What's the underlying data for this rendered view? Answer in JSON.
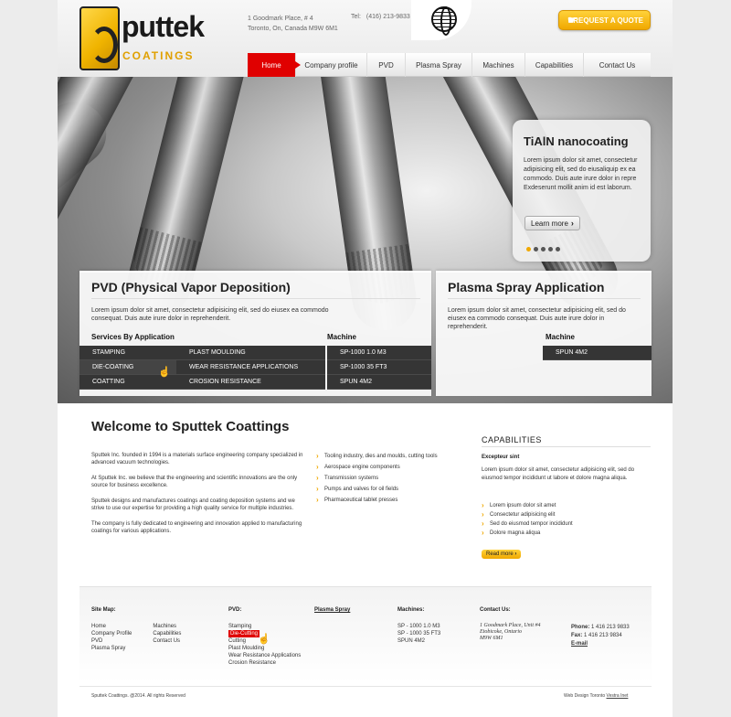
{
  "colors": {
    "accent_red": "#e00000",
    "accent_yellow": "#f0a800",
    "dark_panel": "#353535"
  },
  "header": {
    "logo_word": "puttek",
    "logo_sub": "COATINGS",
    "address_line1": "1 Goodmark Place, # 4",
    "address_line2": "Toronto, On, Canada M9W 6M1",
    "tel_label": "Tel:",
    "tel_value": "(416) 213-9833",
    "quote_button": "REQUEST A QUOTE",
    "globe_icon": "globe-icon"
  },
  "nav": {
    "items": [
      {
        "label": "Home",
        "active": true
      },
      {
        "label": "Company profile"
      },
      {
        "label": "PVD"
      },
      {
        "label": "Plasma Spray"
      },
      {
        "label": "Machines"
      },
      {
        "label": "Capabilities"
      },
      {
        "label": "Contact Us"
      }
    ]
  },
  "promo": {
    "title": "TiAlN nanocoating",
    "text": "Lorem ipsum dolor sit amet, consectetur adipisicing elit, sed do eiusaliquip ex ea commodo. Duis aute irure dolor in repre Exdeserunt mollit anim id est laborum.",
    "learn_more": "Learn more",
    "slides_total": 5,
    "active_slide": 1
  },
  "pvd_panel": {
    "title": "PVD (Physical Vapor Deposition)",
    "desc": "Lorem ipsum dolor sit amet, consectetur adipisicing elit, sed do eiusex ea commodo consequat. Duis aute irure dolor in reprehenderit.",
    "services_head": "Services By Application",
    "services_col1": [
      "STAMPING",
      "DIE-COATING",
      "COATTING"
    ],
    "services_col2": [
      "PLAST MOULDING",
      "WEAR RESISTANCE APPLICATIONS",
      "CROSION RESISTANCE"
    ],
    "machine_head": "Machine",
    "machines": [
      "SP-1000  1.0 M3",
      "SP-1000  35 FT3",
      "SPUN 4M2"
    ]
  },
  "plasma_panel": {
    "title": "Plasma Spray Application",
    "desc": "Lorem ipsum dolor sit amet, consectetur adipisicing elit, sed do eiusex ea commodo consequat. Duis aute irure dolor in reprehenderit.",
    "machine_head": "Machine",
    "machines": [
      "SPUN 4M2"
    ]
  },
  "welcome": {
    "title": "Welcome to Sputtek Coattings",
    "paragraphs": [
      "Sputtek Inc. founded in 1994 is a materials surface engineering company specialized in advanced vacuum technologies.",
      "At Sputtek Inc. we believe that the engineering and scientific innovations are the only source for business excellence.",
      "Sputtek designs and manufactures coatings and coating deposition systems and we strive to use our expertise for providing a high quality service for multiple industries.",
      "The company is fully dedicated to engineering and innovation applied to manufacturing coatings for various applications."
    ],
    "bullets": [
      "Tooling industry, dies and moulds, cutting tools",
      "Aerospace engine components",
      "Transmission systems",
      "Pumps and valves for oil fields",
      "Pharmaceutical tablet presses"
    ]
  },
  "capabilities": {
    "title": "CAPABILITIES",
    "subtitle": "Excepteur sint",
    "text": "Lorem ipsum dolor sit amet, consectetur adipisicing elit, sed do eiusmod tempor incididunt ut labore et dolore magna aliqua.",
    "list": [
      "Lorem ipsum dolor sit amet",
      "Consectetur adipisicing elit",
      "Sed do eiusmod tempor incididunt",
      "Dolore magna aliqua"
    ],
    "read_more": "Read more"
  },
  "footer": {
    "sitemap_head": "Site Map:",
    "sitemap_col1": [
      "Home",
      "Company Profile",
      "PVD",
      "Plasma Spray"
    ],
    "sitemap_col2": [
      "Machines",
      "Capabilities",
      "Contact Us"
    ],
    "pvd_head": "PVD:",
    "pvd_links": [
      "Stamping",
      "Die-Cutting",
      "Cutting",
      "Plast Moulding",
      "Wear Resistance Applications",
      "Crosion Resistance"
    ],
    "plasma_head": "Plasma Spray",
    "machines_head": "Machines:",
    "machines_links": [
      "SP - 1000 1.0 M3",
      "SP - 1000 35 FT3",
      "SPUN 4M2"
    ],
    "contact_head": "Contact Us:",
    "contact_addr": [
      "1 Goodmark Place, Unit #4",
      "Etobicoke, Ontario",
      "M9W 6M1"
    ],
    "phone_label": "Phone:",
    "phone_value": "1 416 213 9833",
    "fax_label": "Fax:",
    "fax_value": "1 416 213 9834",
    "email_label": "E-mail",
    "copyright": "Sputtek Coattings. @2014. All rights Reserved",
    "credit_text": "Web Design Toronto",
    "credit_link": "Vestra Inet"
  }
}
